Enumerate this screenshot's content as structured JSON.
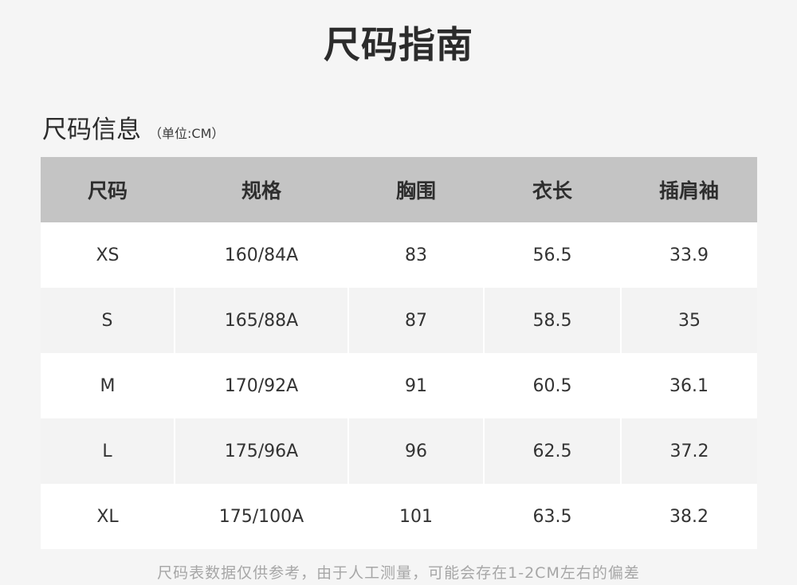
{
  "page": {
    "title": "尺码指南"
  },
  "section": {
    "title": "尺码信息",
    "unit": "（单位:CM）"
  },
  "table": {
    "columns": [
      "尺码",
      "规格",
      "胸围",
      "衣长",
      "插肩袖"
    ],
    "rows": [
      [
        "XS",
        "160/84A",
        "83",
        "56.5",
        "33.9"
      ],
      [
        "S",
        "165/88A",
        "87",
        "58.5",
        "35"
      ],
      [
        "M",
        "170/92A",
        "91",
        "60.5",
        "36.1"
      ],
      [
        "L",
        "175/96A",
        "96",
        "62.5",
        "37.2"
      ],
      [
        "XL",
        "175/100A",
        "101",
        "63.5",
        "38.2"
      ]
    ]
  },
  "footer": {
    "note": "尺码表数据仅供参考，由于人工测量，可能会存在1-2CM左右的偏差"
  },
  "colors": {
    "header_background": "#c4c4c4",
    "page_background": "#f5f5f5",
    "row_light": "#ffffff",
    "row_shaded": "#f3f3f3",
    "note_text": "#a6a6a6"
  }
}
